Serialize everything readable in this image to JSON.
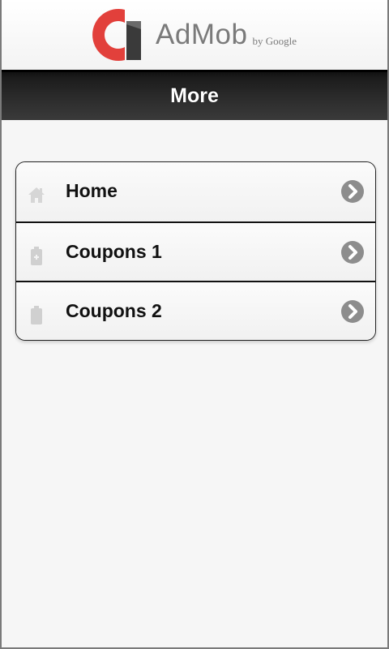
{
  "ad_banner": {
    "brand": "AdMob",
    "byline": "by Google",
    "colors": {
      "red": "#e2403b",
      "dark": "#3a3a3a",
      "grey": "#7a7a7a"
    }
  },
  "header": {
    "title": "More"
  },
  "menu": {
    "items": [
      {
        "label": "Home",
        "icon": "home-icon"
      },
      {
        "label": "Coupons 1",
        "icon": "coupon-icon"
      },
      {
        "label": "Coupons 2",
        "icon": "coupon-icon"
      }
    ]
  }
}
